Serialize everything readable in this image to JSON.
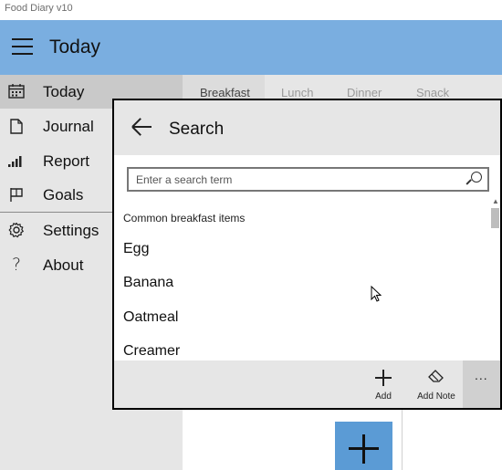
{
  "window": {
    "title": "Food Diary v10"
  },
  "header": {
    "title": "Today"
  },
  "sidebar": {
    "items": [
      {
        "label": "Today",
        "icon": "calendar-icon",
        "active": true
      },
      {
        "label": "Journal",
        "icon": "document-icon",
        "active": false
      },
      {
        "label": "Report",
        "icon": "bar-chart-icon",
        "active": false
      },
      {
        "label": "Goals",
        "icon": "flag-icon",
        "active": false
      },
      {
        "label": "Settings",
        "icon": "gear-icon",
        "active": false
      },
      {
        "label": "About",
        "icon": "question-icon",
        "active": false
      }
    ]
  },
  "meal_tabs": [
    "Breakfast",
    "Lunch",
    "Dinner",
    "Snack"
  ],
  "search_dialog": {
    "title": "Search",
    "search_placeholder": "Enter a search term",
    "search_value": "",
    "section_label": "Common breakfast items",
    "items": [
      "Egg",
      "Banana",
      "Oatmeal",
      "Creamer"
    ],
    "commands": {
      "add": "Add",
      "add_note": "Add Note",
      "more": "..."
    }
  },
  "colors": {
    "header_bg": "#7aaee0",
    "sidebar_bg": "#e6e6e6",
    "selected_bg": "#c9c9c9",
    "fab_bg": "#5b9bd5"
  }
}
